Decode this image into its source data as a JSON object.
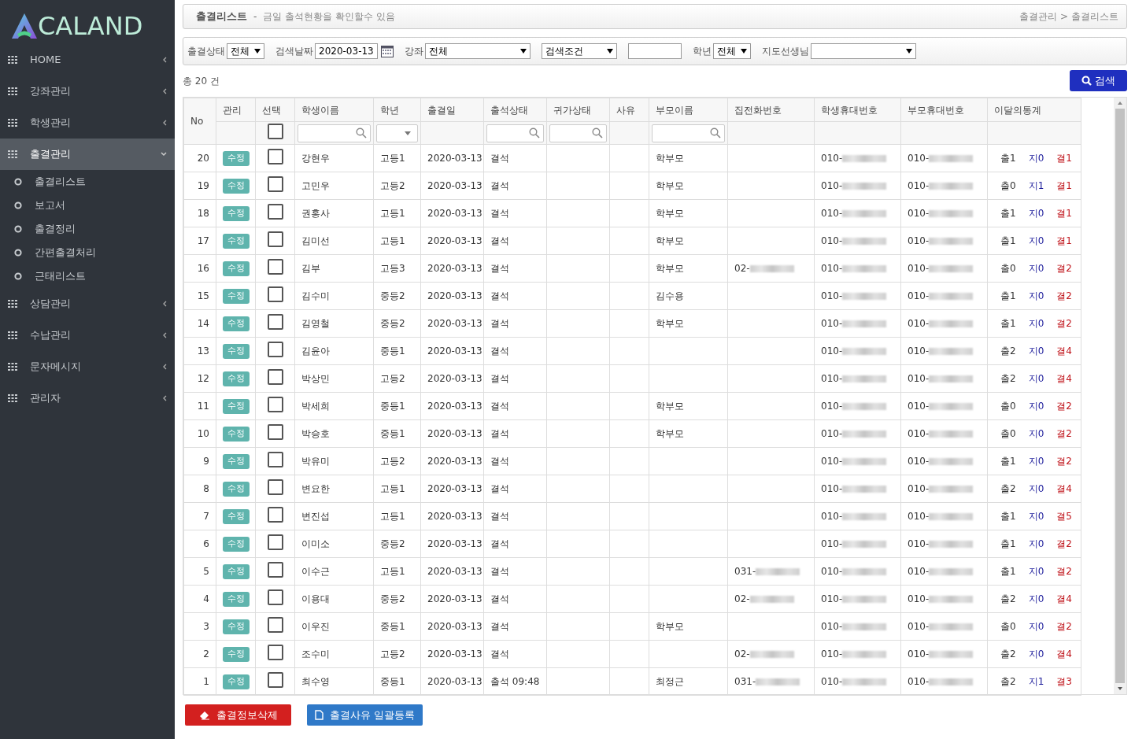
{
  "logo": {
    "text": "CALAND"
  },
  "sidebar": {
    "items": [
      {
        "label": "HOME",
        "expanded": false
      },
      {
        "label": "강좌관리",
        "expanded": false
      },
      {
        "label": "학생관리",
        "expanded": false
      },
      {
        "label": "출결관리",
        "expanded": true,
        "children": [
          {
            "label": "출결리스트"
          },
          {
            "label": "보고서"
          },
          {
            "label": "출결정리"
          },
          {
            "label": "간편출결처리"
          },
          {
            "label": "근태리스트"
          }
        ]
      },
      {
        "label": "상담관리",
        "expanded": false
      },
      {
        "label": "수납관리",
        "expanded": false
      },
      {
        "label": "문자메시지",
        "expanded": false
      },
      {
        "label": "관리자",
        "expanded": false
      }
    ]
  },
  "page_header": {
    "title": "출결리스트",
    "separator": "-",
    "subtitle": "금일 출석현황을 확인할수 있음",
    "breadcrumb": [
      "출결관리",
      ">",
      "출결리스트"
    ]
  },
  "filters": [
    {
      "kind": "select",
      "label": "출결상태",
      "value": "전체"
    },
    {
      "kind": "date",
      "label": "검색날짜",
      "value": "2020-03-13"
    },
    {
      "kind": "select",
      "label": "강좌",
      "value": "전체"
    },
    {
      "kind": "select",
      "value": "검색조건"
    },
    {
      "kind": "text"
    },
    {
      "kind": "select",
      "label": "학년",
      "value": "전체"
    },
    {
      "kind": "select",
      "label": "지도선생님"
    }
  ],
  "total": "총 20 건",
  "search_button": "검색",
  "table": {
    "columns": [
      {
        "label": "No"
      },
      {
        "label": "관리",
        "kind": "none"
      },
      {
        "label": "선택",
        "kind": "checkbox"
      },
      {
        "label": "학생이름",
        "kind": "search"
      },
      {
        "label": "학년",
        "kind": "dropdown"
      },
      {
        "label": "출결일",
        "kind": "none"
      },
      {
        "label": "출석상태",
        "kind": "search"
      },
      {
        "label": "귀가상태",
        "kind": "search"
      },
      {
        "label": "사유",
        "kind": "none"
      },
      {
        "label": "부모이름",
        "kind": "search"
      },
      {
        "label": "집전화번호",
        "kind": "none"
      },
      {
        "label": "학생휴대번호",
        "kind": "none"
      },
      {
        "label": "부모휴대번호",
        "kind": "none"
      },
      {
        "label": "이달의통계",
        "kind": "none"
      }
    ],
    "header_checked": false,
    "rows": [
      {
        "no": "20",
        "edit": "수정",
        "checked": false,
        "name": "강현우",
        "grade": "고등1",
        "date": "2020-03-13",
        "status": "결석",
        "parent": "학부모",
        "student_phone": {
          "prefix": "010-",
          "masked": true
        },
        "parent_phone": {
          "prefix": "010-",
          "masked": true
        },
        "stats": [
          "출1",
          "지0",
          "결1"
        ]
      },
      {
        "no": "19",
        "edit": "수정",
        "checked": false,
        "name": "고민우",
        "grade": "고등2",
        "date": "2020-03-13",
        "status": "결석",
        "parent": "학부모",
        "student_phone": {
          "prefix": "010-",
          "masked": true
        },
        "parent_phone": {
          "prefix": "010-",
          "masked": true
        },
        "stats": [
          "출0",
          "지1",
          "결1"
        ]
      },
      {
        "no": "18",
        "edit": "수정",
        "checked": false,
        "name": "권홍사",
        "grade": "고등1",
        "date": "2020-03-13",
        "status": "결석",
        "parent": "학부모",
        "student_phone": {
          "prefix": "010-",
          "masked": true
        },
        "parent_phone": {
          "prefix": "010-",
          "masked": true
        },
        "stats": [
          "출1",
          "지0",
          "결1"
        ]
      },
      {
        "no": "17",
        "edit": "수정",
        "checked": false,
        "name": "김미선",
        "grade": "고등1",
        "date": "2020-03-13",
        "status": "결석",
        "parent": "학부모",
        "student_phone": {
          "prefix": "010-",
          "masked": true
        },
        "parent_phone": {
          "prefix": "010-",
          "masked": true
        },
        "stats": [
          "출1",
          "지0",
          "결1"
        ]
      },
      {
        "no": "16",
        "edit": "수정",
        "checked": false,
        "name": "김부",
        "grade": "고등3",
        "date": "2020-03-13",
        "status": "결석",
        "parent": "학부모",
        "home_phone": {
          "prefix": "02-",
          "masked": true
        },
        "student_phone": {
          "prefix": "010-",
          "masked": true
        },
        "parent_phone": {
          "prefix": "010-",
          "masked": true
        },
        "stats": [
          "출0",
          "지0",
          "결2"
        ]
      },
      {
        "no": "15",
        "edit": "수정",
        "checked": false,
        "name": "김수미",
        "grade": "중등2",
        "date": "2020-03-13",
        "status": "결석",
        "parent": "김수용",
        "student_phone": {
          "prefix": "010-",
          "masked": true
        },
        "parent_phone": {
          "prefix": "010-",
          "masked": true
        },
        "stats": [
          "출1",
          "지0",
          "결2"
        ]
      },
      {
        "no": "14",
        "edit": "수정",
        "checked": false,
        "name": "김영철",
        "grade": "중등2",
        "date": "2020-03-13",
        "status": "결석",
        "parent": "학부모",
        "student_phone": {
          "prefix": "010-",
          "masked": true
        },
        "parent_phone": {
          "prefix": "010-",
          "masked": true
        },
        "stats": [
          "출1",
          "지0",
          "결2"
        ]
      },
      {
        "no": "13",
        "edit": "수정",
        "checked": false,
        "name": "김윤아",
        "grade": "중등1",
        "date": "2020-03-13",
        "status": "결석",
        "student_phone": {
          "prefix": "010-",
          "masked": true
        },
        "parent_phone": {
          "prefix": "010-",
          "masked": true
        },
        "stats": [
          "출2",
          "지0",
          "결4"
        ]
      },
      {
        "no": "12",
        "edit": "수정",
        "checked": false,
        "name": "박상민",
        "grade": "고등2",
        "date": "2020-03-13",
        "status": "결석",
        "student_phone": {
          "prefix": "010-",
          "masked": true
        },
        "parent_phone": {
          "prefix": "010-",
          "masked": true
        },
        "stats": [
          "출2",
          "지0",
          "결4"
        ]
      },
      {
        "no": "11",
        "edit": "수정",
        "checked": false,
        "name": "박세희",
        "grade": "중등1",
        "date": "2020-03-13",
        "status": "결석",
        "parent": "학부모",
        "student_phone": {
          "prefix": "010-",
          "masked": true
        },
        "parent_phone": {
          "prefix": "010-",
          "masked": true
        },
        "stats": [
          "출0",
          "지0",
          "결2"
        ]
      },
      {
        "no": "10",
        "edit": "수정",
        "checked": false,
        "name": "박승호",
        "grade": "중등1",
        "date": "2020-03-13",
        "status": "결석",
        "parent": "학부모",
        "student_phone": {
          "prefix": "010-",
          "masked": true
        },
        "parent_phone": {
          "prefix": "010-",
          "masked": true
        },
        "stats": [
          "출0",
          "지0",
          "결2"
        ]
      },
      {
        "no": "9",
        "edit": "수정",
        "checked": false,
        "name": "박유미",
        "grade": "고등2",
        "date": "2020-03-13",
        "status": "결석",
        "student_phone": {
          "prefix": "010-",
          "masked": true
        },
        "parent_phone": {
          "prefix": "010-",
          "masked": true
        },
        "stats": [
          "출1",
          "지0",
          "결2"
        ]
      },
      {
        "no": "8",
        "edit": "수정",
        "checked": false,
        "name": "변요한",
        "grade": "고등1",
        "date": "2020-03-13",
        "status": "결석",
        "student_phone": {
          "prefix": "010-",
          "masked": true
        },
        "parent_phone": {
          "prefix": "010-",
          "masked": true
        },
        "stats": [
          "출2",
          "지0",
          "결4"
        ]
      },
      {
        "no": "7",
        "edit": "수정",
        "checked": false,
        "name": "변진섭",
        "grade": "고등1",
        "date": "2020-03-13",
        "status": "결석",
        "student_phone": {
          "prefix": "010-",
          "masked": true
        },
        "parent_phone": {
          "prefix": "010-",
          "masked": true
        },
        "stats": [
          "출1",
          "지0",
          "결5"
        ]
      },
      {
        "no": "6",
        "edit": "수정",
        "checked": false,
        "name": "이미소",
        "grade": "중등2",
        "date": "2020-03-13",
        "status": "결석",
        "student_phone": {
          "prefix": "010-",
          "masked": true
        },
        "parent_phone": {
          "prefix": "010-",
          "masked": true
        },
        "stats": [
          "출1",
          "지0",
          "결2"
        ]
      },
      {
        "no": "5",
        "edit": "수정",
        "checked": false,
        "name": "이수근",
        "grade": "고등1",
        "date": "2020-03-13",
        "status": "결석",
        "home_phone": {
          "prefix": "031-",
          "masked": true
        },
        "student_phone": {
          "prefix": "010-",
          "masked": true
        },
        "parent_phone": {
          "prefix": "010-",
          "masked": true
        },
        "stats": [
          "출1",
          "지0",
          "결2"
        ]
      },
      {
        "no": "4",
        "edit": "수정",
        "checked": false,
        "name": "이용대",
        "grade": "중등2",
        "date": "2020-03-13",
        "status": "결석",
        "home_phone": {
          "prefix": "02-",
          "masked": true
        },
        "student_phone": {
          "prefix": "010-",
          "masked": true
        },
        "parent_phone": {
          "prefix": "010-",
          "masked": true
        },
        "stats": [
          "출2",
          "지0",
          "결4"
        ]
      },
      {
        "no": "3",
        "edit": "수정",
        "checked": false,
        "name": "이우진",
        "grade": "중등1",
        "date": "2020-03-13",
        "status": "결석",
        "parent": "학부모",
        "student_phone": {
          "prefix": "010-",
          "masked": true
        },
        "parent_phone": {
          "prefix": "010-",
          "masked": true
        },
        "stats": [
          "출0",
          "지0",
          "결2"
        ]
      },
      {
        "no": "2",
        "edit": "수정",
        "checked": false,
        "name": "조수미",
        "grade": "고등2",
        "date": "2020-03-13",
        "status": "결석",
        "home_phone": {
          "prefix": "02-",
          "masked": true
        },
        "student_phone": {
          "prefix": "010-",
          "masked": true
        },
        "parent_phone": {
          "prefix": "010-",
          "masked": true
        },
        "stats": [
          "출2",
          "지0",
          "결4"
        ]
      },
      {
        "no": "1",
        "edit": "수정",
        "checked": false,
        "name": "최수영",
        "grade": "중등1",
        "date": "2020-03-13",
        "status": "출석 09:48",
        "parent": "최정근",
        "home_phone": {
          "prefix": "031-",
          "masked": true
        },
        "student_phone": {
          "prefix": "010-",
          "masked": true
        },
        "parent_phone": {
          "prefix": "010-",
          "masked": true
        },
        "stats": [
          "출2",
          "지1",
          "결3"
        ]
      }
    ]
  },
  "footer_buttons": [
    {
      "kind": "delete",
      "label": "출결정보삭제"
    },
    {
      "kind": "register",
      "label": "출결사유 일괄등록"
    }
  ]
}
